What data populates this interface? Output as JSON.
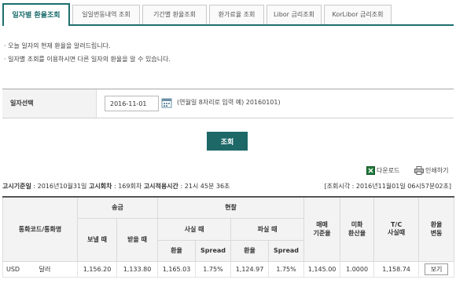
{
  "tabs": [
    {
      "label": "일자별 환율조회"
    },
    {
      "label": "일일변동내역 조회"
    },
    {
      "label": "기간별 환율조회"
    },
    {
      "label": "환가료율 조회"
    },
    {
      "label": "Libor 금리조회"
    },
    {
      "label": "KorLibor 금리조회"
    }
  ],
  "notes": [
    "· 오늘 일자의 현재 환율을 알려드립니다.",
    "· 일자별 조회를 이용하시면 다른 일자의 환율을 알 수 있습니다."
  ],
  "search": {
    "label": "일자선택",
    "date_value": "2016-11-01",
    "hint": "(연월일 8자리로 입력 예) 20160101)",
    "submit_label": "조회"
  },
  "actions": {
    "download": "다운로드",
    "print": "인쇄하기"
  },
  "info": {
    "base_date_label": "고시기준일",
    "base_date_value": ": 2016년10월31일",
    "round_label": "고시회차",
    "round_value": ": 169회차",
    "apply_time_label": "고시적용시간",
    "apply_time_value": ": 21시 45분 36초",
    "query_time": "[조회시각 : 2016년11월01일 06시57분02초]"
  },
  "table": {
    "h_currency": "통화코드/통화명",
    "h_remit": "송금",
    "h_cash": "현찰",
    "h_send": "보낼 때",
    "h_receive": "받을 때",
    "h_buy": "사실 때",
    "h_sell": "파실 때",
    "h_rate1": "환율",
    "h_spread1": "Spread",
    "h_rate2": "환율",
    "h_spread2": "Spread",
    "h_base": "매매\n기준율",
    "h_usd": "미화\n환산율",
    "h_tc": "T/C\n사실때",
    "h_change": "환율\n변동",
    "rows": [
      {
        "code": "USD",
        "name": "달러",
        "send": "1,156.20",
        "receive": "1,133.80",
        "buy_rate": "1,165.03",
        "buy_spread": "1.75%",
        "sell_rate": "1,124.97",
        "sell_spread": "1.75%",
        "base": "1,145.00",
        "usd": "1.0000",
        "tc": "1,158.74",
        "view": "보기"
      }
    ]
  },
  "colors": {
    "accent": "#1e6e6e",
    "button": "#1e6868"
  }
}
